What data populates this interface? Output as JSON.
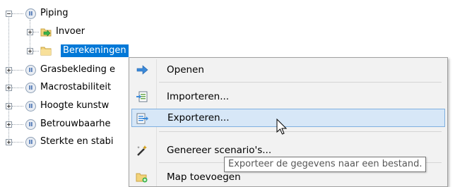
{
  "tree": {
    "root": {
      "label": "Piping",
      "badge": "ll"
    },
    "children": [
      {
        "label": "Invoer"
      },
      {
        "label": "Berekeningen"
      }
    ],
    "siblings": [
      {
        "label": "Grasbekleding e",
        "badge": "ll"
      },
      {
        "label": "Macrostabiliteit",
        "badge": "ll"
      },
      {
        "label": "Hoogte kunstw",
        "badge": "ll"
      },
      {
        "label": "Betrouwbaarhe",
        "badge": "ll"
      },
      {
        "label": "Sterkte en stabi",
        "badge": "ll"
      }
    ]
  },
  "context_menu": {
    "items": [
      {
        "label": "Openen",
        "icon": "arrow-right-icon"
      },
      {
        "label": "Importeren...",
        "icon": "import-icon"
      },
      {
        "label": "Exporteren...",
        "icon": "export-icon",
        "hovered": true
      },
      {
        "label": "Genereer scenario's...",
        "icon": "wand-icon"
      },
      {
        "label": "Map toevoegen",
        "icon": "folder-add-icon"
      }
    ]
  },
  "tooltip": {
    "text": "Exporteer de gegevens naar een bestand."
  },
  "colors": {
    "selection": "#0078d7",
    "menu_background": "#f2f2f2",
    "menu_hover": "#d7e7f7",
    "menu_hover_border": "#7fb0e0",
    "tree_line": "#9aa3ad"
  }
}
